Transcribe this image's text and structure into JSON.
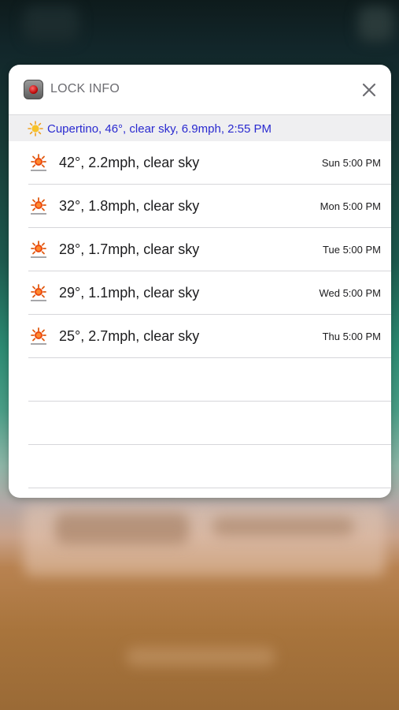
{
  "widget": {
    "app_title": "LOCK INFO",
    "close_icon": "close-icon",
    "app_icon": "lock-info-app-icon"
  },
  "current": {
    "icon": "sun-icon",
    "text": "Cupertino, 46°, clear sky, 6.9mph, 2:55 PM"
  },
  "forecast": [
    {
      "icon": "sunny-weather-icon",
      "condition": "42°, 2.2mph, clear sky",
      "time": "Sun 5:00 PM"
    },
    {
      "icon": "sunny-weather-icon",
      "condition": "32°, 1.8mph, clear sky",
      "time": "Mon 5:00 PM"
    },
    {
      "icon": "sunny-weather-icon",
      "condition": "28°, 1.7mph, clear sky",
      "time": "Tue 5:00 PM"
    },
    {
      "icon": "sunny-weather-icon",
      "condition": "29°, 1.1mph, clear sky",
      "time": "Wed 5:00 PM"
    },
    {
      "icon": "sunny-weather-icon",
      "condition": "25°, 2.7mph, clear sky",
      "time": "Thu 5:00 PM"
    }
  ],
  "colors": {
    "current_text": "#2a2ad0",
    "card_background": "#ffffff",
    "header_strip": "#efeff1"
  }
}
